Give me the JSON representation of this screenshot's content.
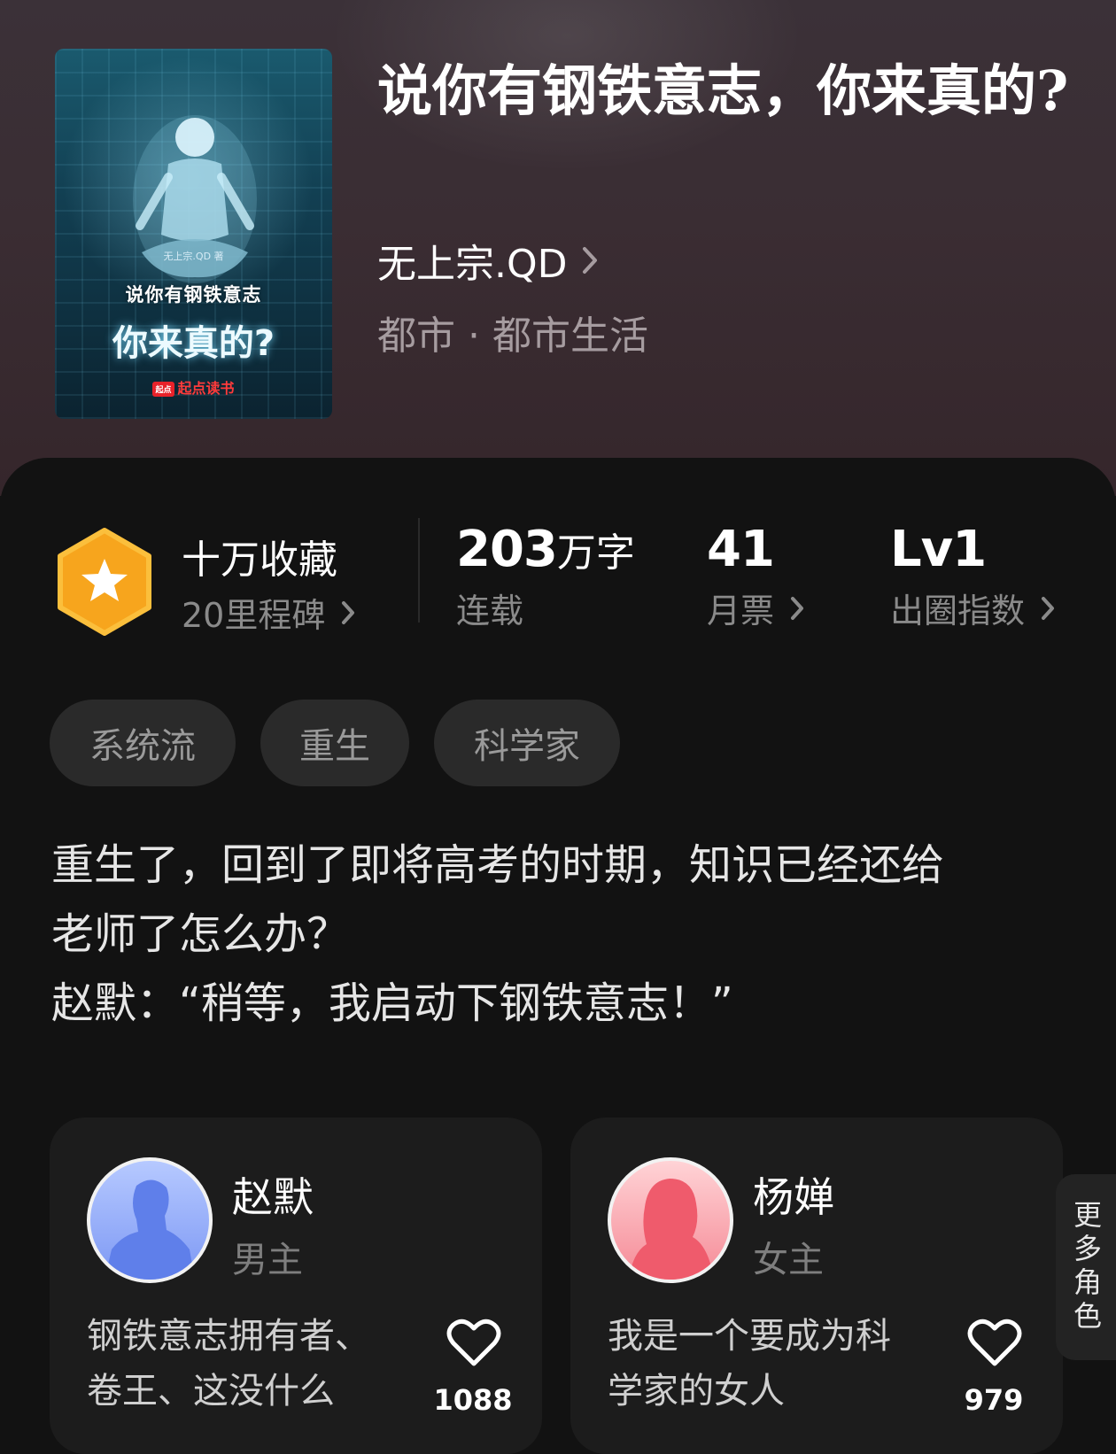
{
  "book": {
    "title": "说你有钢铁意志，你来真的?",
    "author": "无上宗.QD",
    "genre": "都市 · 都市生活",
    "cover": {
      "author_credit": "无上宗.QD 著",
      "title_line1": "说你有钢铁意志",
      "title_line2": "你来真的?",
      "brand_logo": "起点",
      "brand": "起点读书"
    }
  },
  "stats": {
    "collection": {
      "title": "十万收藏",
      "sub": "20里程碑"
    },
    "words": {
      "value": "203",
      "unit": "万字",
      "label": "连载"
    },
    "monthly": {
      "value": "41",
      "label": "月票"
    },
    "index": {
      "value": "Lv1",
      "label": "出圈指数"
    }
  },
  "tags": [
    "系统流",
    "重生",
    "科学家"
  ],
  "intro": [
    "重生了，回到了即将高考的时期，知识已经还给",
    "老师了怎么办？",
    "赵默：“稍等，我启动下钢铁意志！”"
  ],
  "characters": [
    {
      "name": "赵默",
      "role": "男主",
      "desc": [
        "钢铁意志拥有者、",
        "卷王、这没什么"
      ],
      "likes": "1088"
    },
    {
      "name": "杨婵",
      "role": "女主",
      "desc": [
        "我是一个要成为科",
        "学家的女人"
      ],
      "likes": "979"
    }
  ],
  "more_characters": "更多角色",
  "colors": {
    "hero_bg": "#3a2d33",
    "panel_bg": "#121212",
    "badge": "#f7a51d",
    "secondary_text": "#8a8a8a"
  }
}
